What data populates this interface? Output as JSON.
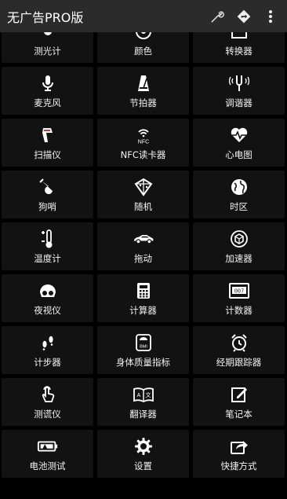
{
  "app_title": "无广告PRO版",
  "actions": [
    {
      "name": "wrench-icon"
    },
    {
      "name": "directions-icon"
    },
    {
      "name": "overflow-menu-icon"
    }
  ],
  "tools": [
    {
      "label": "测光计",
      "icon": "light-meter-icon"
    },
    {
      "label": "颜色",
      "icon": "color-wheel-icon"
    },
    {
      "label": "转换器",
      "icon": "converter-icon"
    },
    {
      "label": "麦克风",
      "icon": "microphone-icon"
    },
    {
      "label": "节拍器",
      "icon": "metronome-icon"
    },
    {
      "label": "调谐器",
      "icon": "tuning-fork-icon"
    },
    {
      "label": "扫描仪",
      "icon": "barcode-scanner-icon"
    },
    {
      "label": "NFC读卡器",
      "icon": "nfc-icon"
    },
    {
      "label": "心电图",
      "icon": "heart-pulse-icon"
    },
    {
      "label": "狗哨",
      "icon": "dog-whistle-icon"
    },
    {
      "label": "随机",
      "icon": "dice-icon"
    },
    {
      "label": "时区",
      "icon": "globe-icon"
    },
    {
      "label": "温度计",
      "icon": "thermometer-icon"
    },
    {
      "label": "拖动",
      "icon": "car-icon"
    },
    {
      "label": "加速器",
      "icon": "accelerometer-icon"
    },
    {
      "label": "夜视仪",
      "icon": "night-vision-icon"
    },
    {
      "label": "计算器",
      "icon": "calculator-icon"
    },
    {
      "label": "计数器",
      "icon": "counter-icon"
    },
    {
      "label": "计步器",
      "icon": "footsteps-icon"
    },
    {
      "label": "身体质量指标",
      "icon": "bmi-scale-icon"
    },
    {
      "label": "经期跟踪器",
      "icon": "alarm-clock-icon"
    },
    {
      "label": "测谎仪",
      "icon": "touch-finger-icon"
    },
    {
      "label": "翻译器",
      "icon": "translator-book-icon"
    },
    {
      "label": "笔记本",
      "icon": "notepad-icon"
    },
    {
      "label": "电池测试",
      "icon": "battery-icon"
    },
    {
      "label": "设置",
      "icon": "gear-icon"
    },
    {
      "label": "快捷方式",
      "icon": "share-shortcut-icon"
    }
  ],
  "colors": {
    "appbar": "#2b2b2b",
    "background": "#000000",
    "tile": "#121212",
    "text": "#ffffff"
  }
}
